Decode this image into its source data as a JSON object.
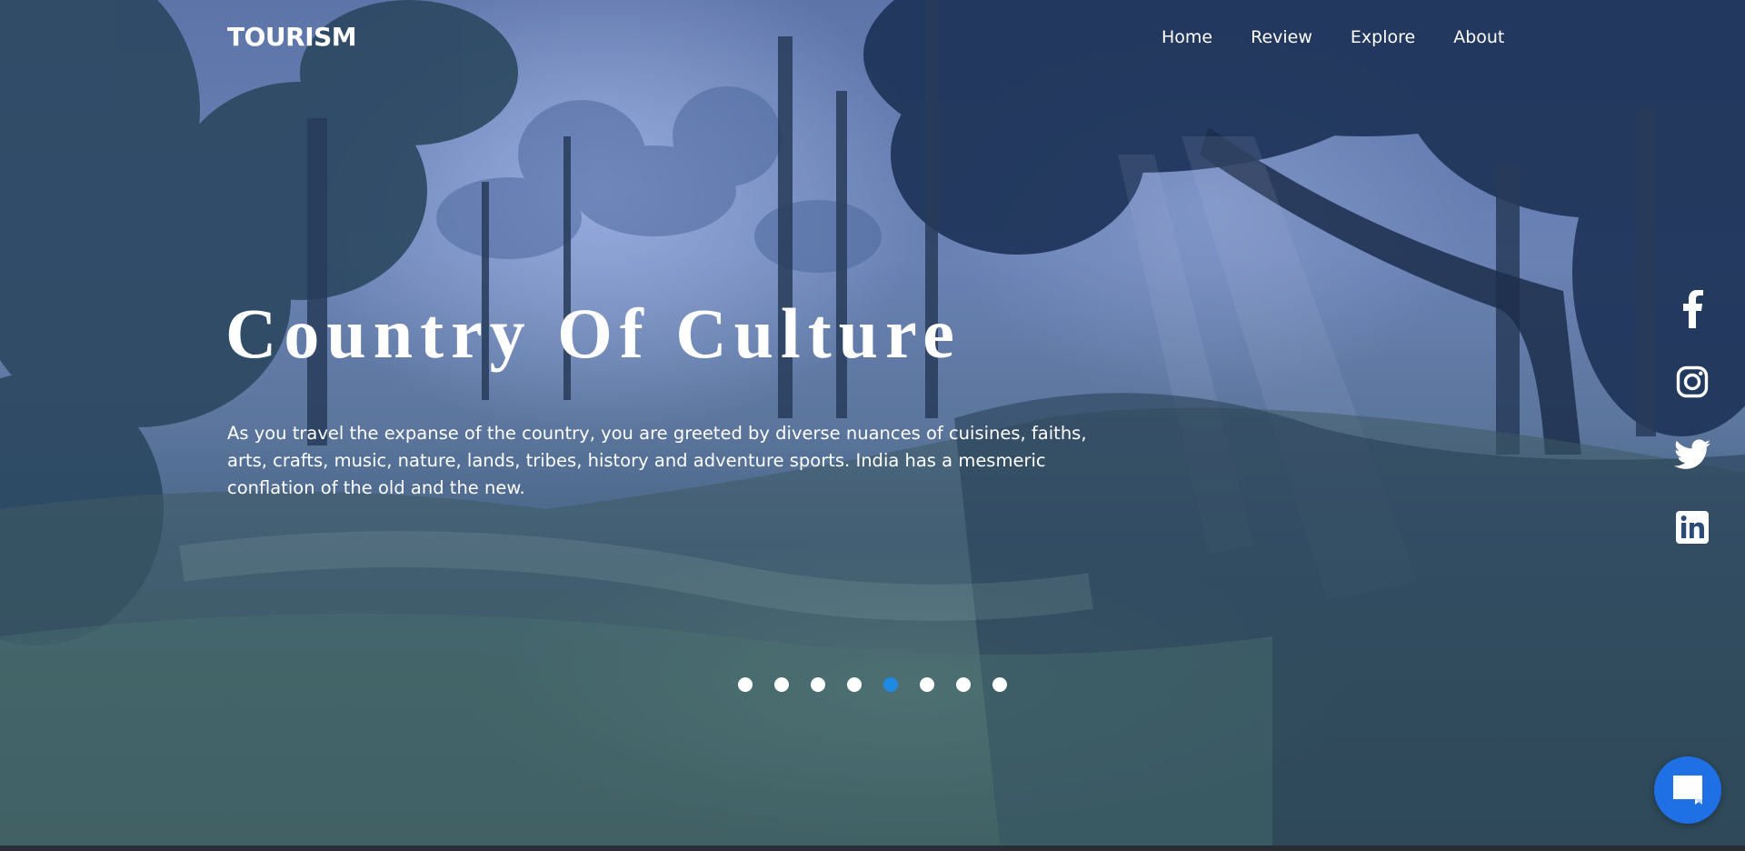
{
  "header": {
    "logo": "TOURISM",
    "nav": [
      {
        "label": "Home"
      },
      {
        "label": "Review"
      },
      {
        "label": "Explore"
      },
      {
        "label": "About"
      }
    ]
  },
  "hero": {
    "title": "Country Of Culture",
    "description": "As you travel the expanse of the country, you are greeted by diverse nuances of cuisines, faiths, arts, crafts, music, nature, lands, tribes, history and adventure sports. India has a mesmeric conflation of the old and the new."
  },
  "slider": {
    "total": 8,
    "active_index": 4
  },
  "social": [
    {
      "icon": "facebook-icon"
    },
    {
      "icon": "instagram-icon"
    },
    {
      "icon": "twitter-icon"
    },
    {
      "icon": "linkedin-icon"
    }
  ],
  "chat": {
    "icon": "chat-icon"
  },
  "colors": {
    "accent": "#1f8ae6",
    "chat_button": "#1f6fe5",
    "text": "#ffffff"
  }
}
